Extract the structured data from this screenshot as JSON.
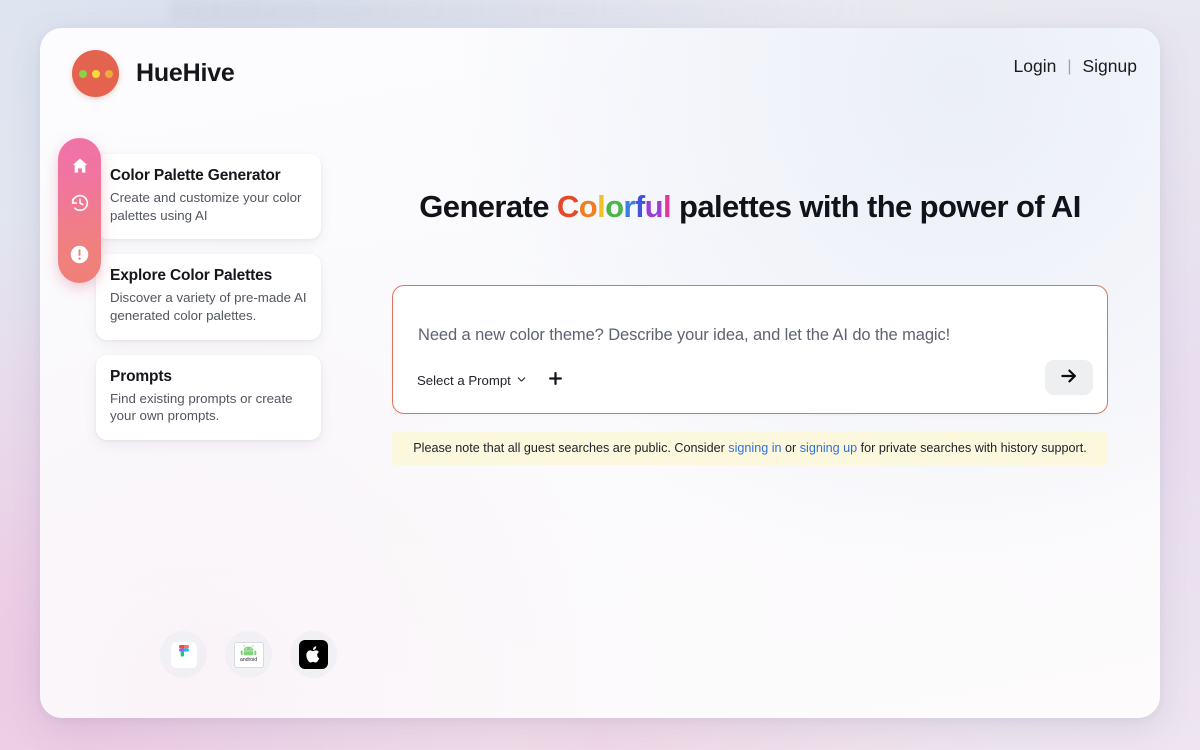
{
  "brand": {
    "name": "HueHive",
    "logo_icon": "three-dots-circle-icon",
    "logo_bg": "#e4634e",
    "dot_colors": [
      "#8ed24a",
      "#f5d93a",
      "#f0a93c"
    ]
  },
  "header": {
    "login_label": "Login",
    "separator": "|",
    "signup_label": "Signup"
  },
  "rail": {
    "items": [
      {
        "name": "home",
        "icon": "home-icon"
      },
      {
        "name": "history",
        "icon": "history-clock-icon"
      },
      {
        "name": "alert",
        "icon": "alert-circle-icon"
      }
    ],
    "gradient_from": "#ef73a8",
    "gradient_to": "#ef7f75"
  },
  "feature_cards": [
    {
      "title": "Color Palette Generator",
      "description": "Create and customize your color palettes using AI"
    },
    {
      "title": "Explore Color Palettes",
      "description": "Discover a variety of pre-made AI generated color palettes."
    },
    {
      "title": "Prompts",
      "description": "Find existing prompts or create your own prompts."
    }
  ],
  "hero": {
    "headline_prefix": "Generate ",
    "headline_rainbow": "Colorful",
    "headline_suffix": " palettes with the power of AI",
    "rainbow_letters": [
      {
        "char": "C",
        "color": "#e8482a"
      },
      {
        "char": "o",
        "color": "#f07f23"
      },
      {
        "char": "l",
        "color": "#f0c22a"
      },
      {
        "char": "o",
        "color": "#49b646"
      },
      {
        "char": "r",
        "color": "#3b7fe0"
      },
      {
        "char": "f",
        "color": "#4055d8"
      },
      {
        "char": "u",
        "color": "#9b3fd4"
      },
      {
        "char": "l",
        "color": "#e0399b"
      }
    ]
  },
  "composer": {
    "placeholder": "Need a new color theme? Describe your idea, and let the AI do the magic!",
    "value": "",
    "select_prompt_label": "Select a Prompt",
    "chevron_icon": "chevron-down-icon",
    "add_icon": "plus-icon",
    "submit_icon": "arrow-right-icon",
    "border_color": "#e0735f"
  },
  "guest_notice": {
    "text_before": "Please note that all guest searches are public. Consider ",
    "link_signin": "signing in",
    "text_middle": " or ",
    "link_signup": "signing up",
    "text_after": " for private searches with history support.",
    "background": "#fcf8dd",
    "link_color": "#2f6fdd"
  },
  "platform_badges": [
    {
      "name": "figma",
      "icon": "figma-icon"
    },
    {
      "name": "android",
      "icon": "android-icon",
      "label": "android"
    },
    {
      "name": "apple",
      "icon": "apple-icon"
    }
  ]
}
